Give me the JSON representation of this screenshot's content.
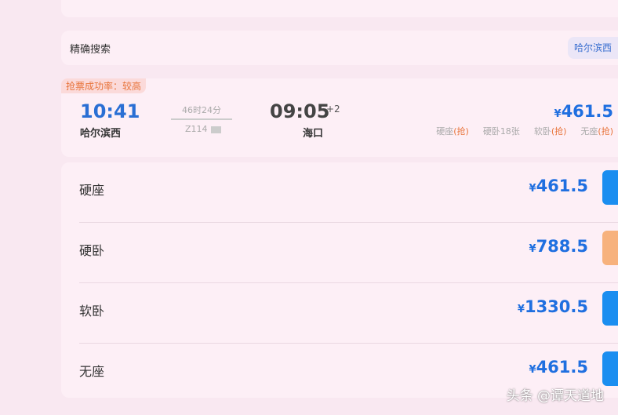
{
  "search": {
    "label": "精确搜索",
    "station_chip": "哈尔滨西"
  },
  "train": {
    "success_rate": "抢票成功率：较高",
    "dep_time": "10:41",
    "dep_station": "哈尔滨西",
    "duration": "46时24分",
    "train_no": "Z114",
    "arr_time": "09:05",
    "day_offset": "+2",
    "arr_station": "海口",
    "currency": "¥",
    "min_price": "461.5",
    "seats": [
      {
        "name": "硬座",
        "status": "(抢)"
      },
      {
        "name": "硬卧",
        "status": "18张"
      },
      {
        "name": "软卧",
        "status": "(抢)"
      },
      {
        "name": "无座",
        "status": "(抢)"
      }
    ]
  },
  "prices": [
    {
      "name": "硬座",
      "price": "461.5",
      "currency": "¥"
    },
    {
      "name": "硬卧",
      "price": "788.5",
      "currency": "¥"
    },
    {
      "name": "软卧",
      "price": "1330.5",
      "currency": "¥"
    },
    {
      "name": "无座",
      "price": "461.5",
      "currency": "¥"
    }
  ],
  "watermark": "头条 @谭天道地",
  "colors": {
    "blue": "#1f6fe0",
    "orange": "#e8743b",
    "button_blue": "#1b8ef0",
    "button_orange": "#f7b27d"
  }
}
